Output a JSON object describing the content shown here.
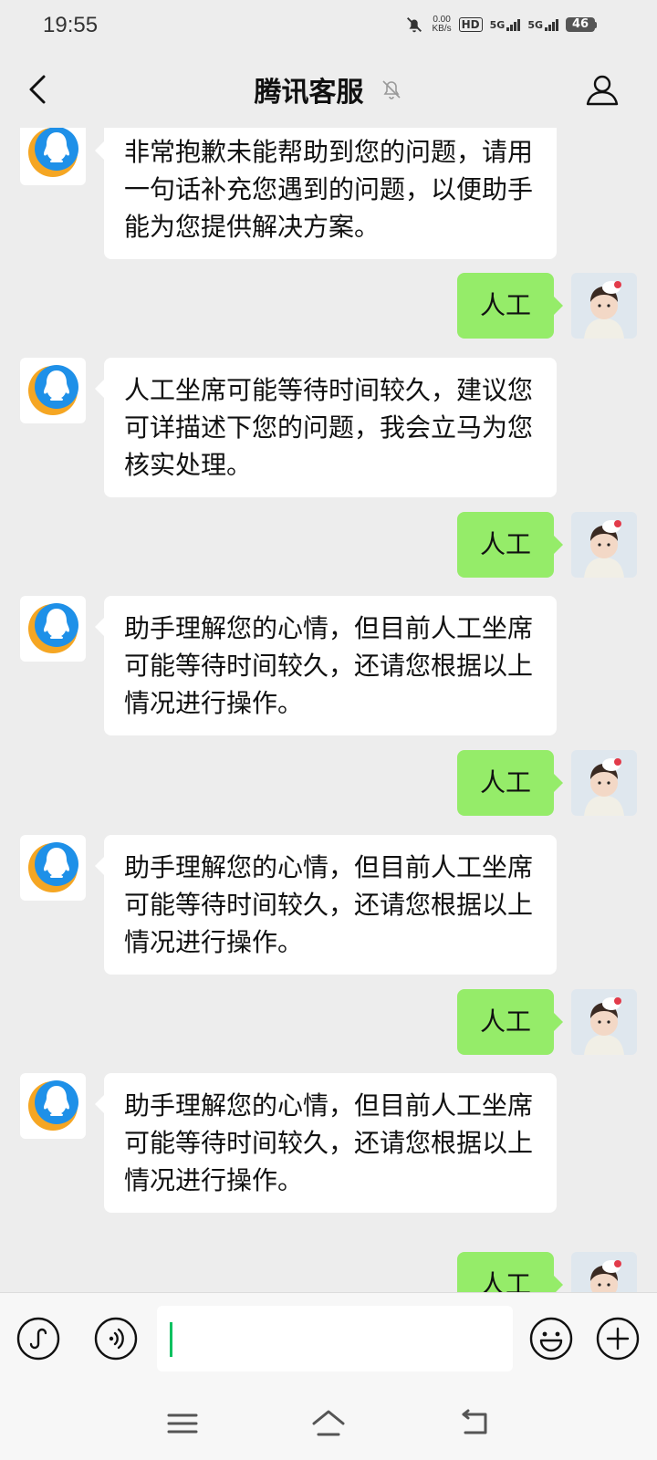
{
  "status_bar": {
    "time": "19:55",
    "net_speed_value": "0.00",
    "net_speed_unit": "KB/s",
    "hd_label": "HD",
    "sim1_label": "5G",
    "sim2_label": "5G",
    "battery_level": "46"
  },
  "header": {
    "title": "腾讯客服"
  },
  "messages": [
    {
      "from": "bot",
      "text": "非常抱歉未能帮助到您的问题，请用一句话补充您遇到的问题，以便助手能为您提供解决方案。"
    },
    {
      "from": "user",
      "text": "人工"
    },
    {
      "from": "bot",
      "text": "人工坐席可能等待时间较久，建议您可详描述下您的问题，我会立马为您核实处理。"
    },
    {
      "from": "user",
      "text": "人工"
    },
    {
      "from": "bot",
      "text": "助手理解您的心情，但目前人工坐席可能等待时间较久，还请您根据以上情况进行操作。"
    },
    {
      "from": "user",
      "text": "人工"
    },
    {
      "from": "bot",
      "text": "助手理解您的心情，但目前人工坐席可能等待时间较久，还请您根据以上情况进行操作。"
    },
    {
      "from": "user",
      "text": "人工"
    },
    {
      "from": "bot",
      "text": "助手理解您的心情，但目前人工坐席可能等待时间较久，还请您根据以上情况进行操作。"
    },
    {
      "from": "user",
      "text": "人工"
    }
  ],
  "input": {
    "value": ""
  },
  "colors": {
    "background": "#ededed",
    "user_bubble": "#95ec69",
    "bot_bubble": "#ffffff",
    "caret": "#07c160"
  }
}
